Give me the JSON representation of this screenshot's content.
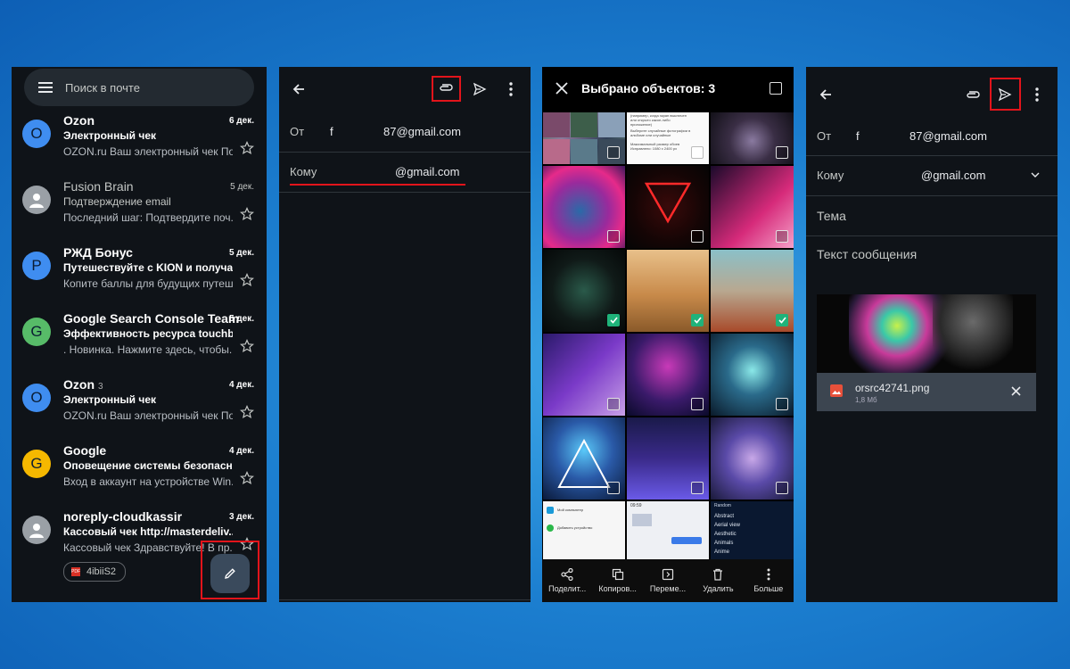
{
  "colors": {
    "highlight": "#e2141b",
    "accent_underline": "#e2141b",
    "check": "#1fb37a"
  },
  "inbox": {
    "search_placeholder": "Поиск в почте",
    "emails": [
      {
        "avatar": "O",
        "avatar_color": "#3f8df0",
        "sender": "Ozon",
        "count": "",
        "date": "6 дек.",
        "subject": "Электронный чек",
        "preview": "OZON.ru Ваш электронный чек По...",
        "unread": true
      },
      {
        "avatar": "",
        "avatar_color": "#9aa0a6",
        "sender": "Fusion Brain",
        "count": "",
        "date": "5 дек.",
        "subject": "Подтверждение email",
        "preview": "Последний шаг: Подтвердите поч...",
        "unread": false
      },
      {
        "avatar": "P",
        "avatar_color": "#3f8df0",
        "sender": "РЖД Бонус",
        "count": "",
        "date": "5 дек.",
        "subject": "Путешествуйте с KION и получа...",
        "preview": "Копите баллы для будущих путеш...",
        "unread": true
      },
      {
        "avatar": "G",
        "avatar_color": "#57bb68",
        "sender": "Google Search Console Team",
        "count": "",
        "date": "5 дек.",
        "subject": "Эффективность ресурса touchb...",
        "preview": ". Новинка. Нажмите здесь, чтобы...",
        "unread": true
      },
      {
        "avatar": "O",
        "avatar_color": "#3f8df0",
        "sender": "Ozon",
        "count": "3",
        "date": "4 дек.",
        "subject": "Электронный чек",
        "preview": "OZON.ru Ваш электронный чек По...",
        "unread": true
      },
      {
        "avatar": "G",
        "avatar_color": "#f5b800",
        "sender": "Google",
        "count": "",
        "date": "4 дек.",
        "subject": "Оповещение системы безопасн...",
        "preview": "Вход в аккаунт на устройстве Win...",
        "unread": true
      },
      {
        "avatar": "",
        "avatar_color": "#9aa0a6",
        "sender": "noreply-cloudkassir",
        "count": "",
        "date": "3 дек.",
        "subject": "Кассовый чек http://masterdeliv...",
        "preview": "Кассовый чек Здравствуйте! В пр...",
        "unread": true,
        "chip": "4ibiiS2"
      }
    ]
  },
  "compose1": {
    "from_label": "От",
    "from_value": "f",
    "from_email": "87@gmail.com",
    "to_label": "Кому",
    "to_email": "@gmail.com"
  },
  "picker": {
    "title": "Выбрано объектов: 3",
    "thumb_texts": {
      "settings_line1": "(например, когда экран выключен",
      "settings_line2": "или открыто какое-либо",
      "settings_line3": "приложение)",
      "settings_line4": "Выберите случайные фотографии в",
      "settings_line5": "альбоме или случайные",
      "settings_line6": "Максимальный размер обоев",
      "settings_line7": "Исправлено: 1080 x 2400 px",
      "phone_left1": "Мой компьютер",
      "phone_left2": "Добавить устройство",
      "phone_mid_time": "09:59",
      "tags_header": "Random",
      "tags": [
        "Abstract",
        "Aerial view",
        "Aesthetic",
        "Animals",
        "Anime"
      ]
    },
    "actions": [
      {
        "icon": "share-icon",
        "label": "Поделит..."
      },
      {
        "icon": "copy-icon",
        "label": "Копиров..."
      },
      {
        "icon": "move-icon",
        "label": "Переме..."
      },
      {
        "icon": "delete-icon",
        "label": "Удалить"
      },
      {
        "icon": "more-icon",
        "label": "Больше"
      }
    ]
  },
  "compose2": {
    "from_label": "От",
    "from_value": "f",
    "from_email": "87@gmail.com",
    "to_label": "Кому",
    "to_email": "@gmail.com",
    "subject_placeholder": "Тема",
    "body_placeholder": "Текст сообщения",
    "attachment_name": "orsrc42741.png",
    "attachment_size": "1,8 Мб"
  }
}
